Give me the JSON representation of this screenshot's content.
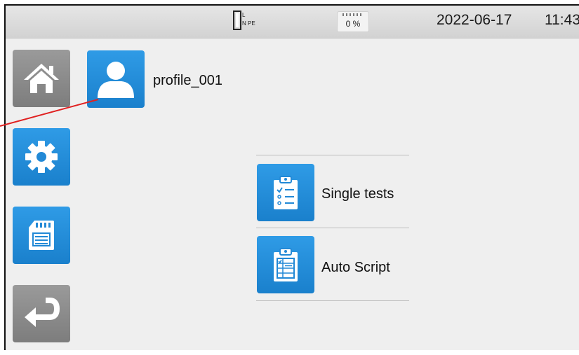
{
  "status": {
    "connection_labels": {
      "l": "L",
      "n": "N",
      "pe": "PE"
    },
    "battery_pct": "0 %",
    "date": "2022-06-17",
    "time": "11:43"
  },
  "sidebar": {
    "items": [
      {
        "name": "home",
        "icon": "home-icon"
      },
      {
        "name": "settings",
        "icon": "gear-icon"
      },
      {
        "name": "memory",
        "icon": "sd-card-icon"
      },
      {
        "name": "back",
        "icon": "return-arrow-icon"
      }
    ]
  },
  "profile": {
    "icon": "user-icon",
    "label": "profile_001"
  },
  "menu": {
    "items": [
      {
        "label": "Single tests",
        "icon": "clipboard-list-icon"
      },
      {
        "label": "Auto Script",
        "icon": "clipboard-script-icon"
      }
    ]
  },
  "colors": {
    "tile_blue": "#1f8ad8",
    "tile_gray": "#8a8a8a",
    "callout": "#e02020"
  }
}
